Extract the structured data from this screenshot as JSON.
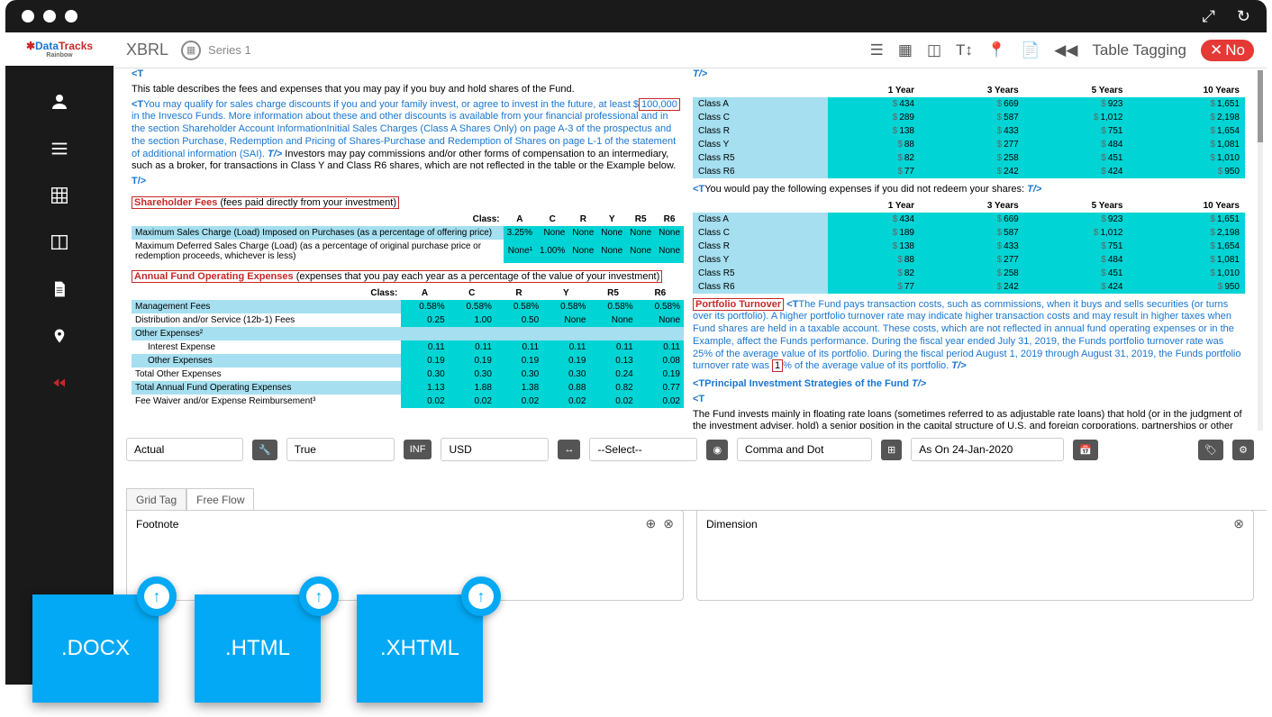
{
  "logo": {
    "red": "Data",
    "blue": "Tracks",
    "rainbow": "Rainbow"
  },
  "toolbar": {
    "title": "XBRL",
    "series": "Series 1",
    "table_tagging": "Table Tagging",
    "no_label": "No"
  },
  "doc": {
    "intro": "This table describes the fees and expenses that you may pay if you buy and hold shares of the Fund.",
    "qualify_prefix": "You may qualify for sales charge discounts if you and your family invest, or agree to invest in the future, at least $",
    "qualify_amount": "100,000",
    "qualify_suffix": " in the Invesco Funds. More information about these and other discounts is available from your financial professional and in the section Shareholder Account InformationInitial Sales Charges (Class A Shares Only) on page A-3 of the prospectus and the section Purchase, Redemption and Pricing of Shares-Purchase and Redemption of Shares on page L-1 of the statement of additional information (SAI).",
    "qualify_tail": " Investors may pay commissions and/or other forms of compensation to an intermediary, such as a broker, for transactions in Class Y and Class R6 shares, which are not reflected in the table or the Example below.",
    "shareholder_title": "Shareholder Fees",
    "shareholder_sub": "(fees paid directly from your investment)",
    "class_label": "Class:",
    "classes": [
      "A",
      "C",
      "R",
      "Y",
      "R5",
      "R6"
    ],
    "fee_rows": [
      {
        "label": "Maximum Sales Charge (Load) Imposed on Purchases (as a percentage of offering price)",
        "vals": [
          "3.25%",
          "None",
          "None",
          "None",
          "None",
          "None"
        ]
      },
      {
        "label": "Maximum Deferred Sales Charge (Load) (as a percentage of original purchase price or redemption proceeds, whichever is less)",
        "vals": [
          "None¹",
          "1.00%",
          "None",
          "None",
          "None",
          "None"
        ]
      }
    ],
    "annual_title": "Annual Fund Operating Expenses",
    "annual_sub": "(expenses that you pay each year as a percentage of the value of your investment)",
    "annual_rows": [
      {
        "label": "Management Fees",
        "vals": [
          "0.58%",
          "0.58%",
          "0.58%",
          "0.58%",
          "0.58%",
          "0.58%"
        ],
        "hl": true
      },
      {
        "label": "Distribution and/or Service (12b-1) Fees",
        "vals": [
          "0.25",
          "1.00",
          "0.50",
          "None",
          "None",
          "None"
        ]
      },
      {
        "label": "Other Expenses²",
        "vals": [
          "",
          "",
          "",
          "",
          "",
          ""
        ],
        "hl": true
      },
      {
        "label": "Interest Expense",
        "indent": true,
        "vals": [
          "0.11",
          "0.11",
          "0.11",
          "0.11",
          "0.11",
          "0.11"
        ]
      },
      {
        "label": "Other Expenses",
        "indent": true,
        "vals": [
          "0.19",
          "0.19",
          "0.19",
          "0.19",
          "0.13",
          "0.08"
        ],
        "hl": true
      },
      {
        "label": "Total Other Expenses",
        "vals": [
          "0.30",
          "0.30",
          "0.30",
          "0.30",
          "0.24",
          "0.19"
        ]
      },
      {
        "label": "Total Annual Fund Operating Expenses",
        "vals": [
          "1.13",
          "1.88",
          "1.38",
          "0.88",
          "0.82",
          "0.77"
        ],
        "hl": true
      },
      {
        "label": "Fee Waiver and/or Expense Reimbursement³",
        "vals": [
          "0.02",
          "0.02",
          "0.02",
          "0.02",
          "0.02",
          "0.02"
        ]
      }
    ]
  },
  "right": {
    "year_heads": [
      "1 Year",
      "3 Years",
      "5 Years",
      "10 Years"
    ],
    "table1": [
      {
        "cls": "Class A",
        "vals": [
          "434",
          "669",
          "923",
          "1,651"
        ]
      },
      {
        "cls": "Class C",
        "vals": [
          "289",
          "587",
          "1,012",
          "2,198"
        ]
      },
      {
        "cls": "Class R",
        "vals": [
          "138",
          "433",
          "751",
          "1,654"
        ]
      },
      {
        "cls": "Class Y",
        "vals": [
          "88",
          "277",
          "484",
          "1,081"
        ]
      },
      {
        "cls": "Class R5",
        "vals": [
          "82",
          "258",
          "451",
          "1,010"
        ]
      },
      {
        "cls": "Class R6",
        "vals": [
          "77",
          "242",
          "424",
          "950"
        ]
      }
    ],
    "note1": "You would pay the following expenses if you did not redeem your shares:",
    "table2": [
      {
        "cls": "Class A",
        "vals": [
          "434",
          "669",
          "923",
          "1,651"
        ]
      },
      {
        "cls": "Class C",
        "vals": [
          "189",
          "587",
          "1,012",
          "2,198"
        ]
      },
      {
        "cls": "Class R",
        "vals": [
          "138",
          "433",
          "751",
          "1,654"
        ]
      },
      {
        "cls": "Class Y",
        "vals": [
          "88",
          "277",
          "484",
          "1,081"
        ]
      },
      {
        "cls": "Class R5",
        "vals": [
          "82",
          "258",
          "451",
          "1,010"
        ]
      },
      {
        "cls": "Class R6",
        "vals": [
          "77",
          "242",
          "424",
          "950"
        ]
      }
    ],
    "portfolio_title": "Portfolio Turnover",
    "portfolio_body": "The Fund pays transaction costs, such as commissions, when it buys and sells securities (or turns over its portfolio). A higher portfolio turnover rate may indicate higher transaction costs and may result in higher taxes when Fund shares are held in a taxable account. These costs, which are not reflected in annual fund operating expenses or in the Example, affect the Funds performance. During the fiscal year ended July 31, 2019, the Funds portfolio turnover rate was 25% of the average value of its portfolio. During the fiscal period August 1, 2019 through August 31, 2019, the Funds portfolio turnover rate was ",
    "portfolio_rate": "1",
    "portfolio_tail": "% of the average value of its portfolio.",
    "strategies_title": "Principal Investment Strategies of the Fund",
    "strategies_body": "The Fund invests mainly in floating rate loans (sometimes referred to as adjustable rate loans) that hold (or in the judgment of the investment adviser, hold) a senior position in the capital structure of U.S. and foreign corporations, partnerships or other"
  },
  "controls": {
    "actual": "Actual",
    "true": "True",
    "inf": "INF",
    "usd": "USD",
    "select": "--Select--",
    "comma": "Comma and Dot",
    "date": "As On 24-Jan-2020"
  },
  "tabs": {
    "grid": "Grid Tag",
    "free": "Free Flow"
  },
  "panels": {
    "footnote": "Footnote",
    "dimension": "Dimension"
  },
  "files": {
    "docx": ".DOCX",
    "html": ".HTML",
    "xhtml": ".XHTML"
  }
}
